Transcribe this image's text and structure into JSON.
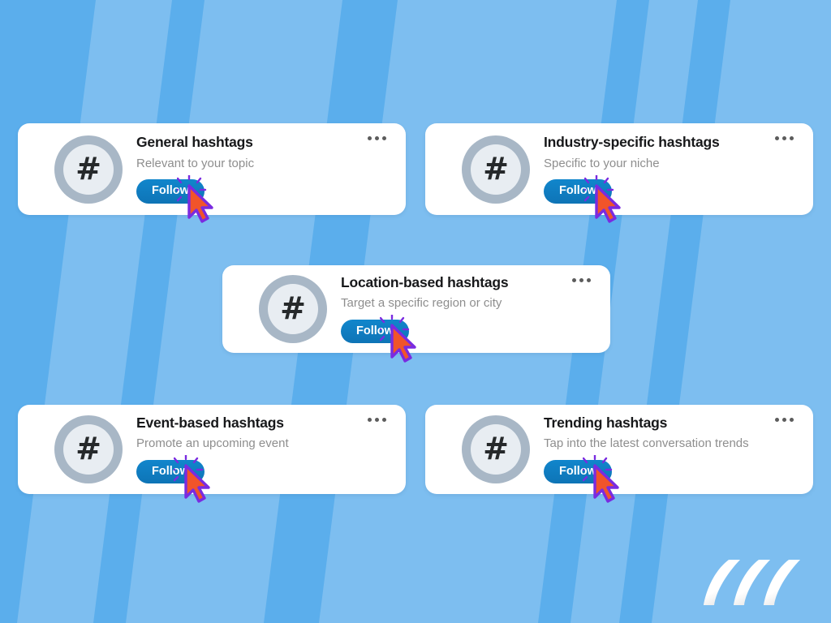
{
  "page": {
    "background_color": "#5BAEEC",
    "stripe_color": "#7DBEF0",
    "card_background": "#FFFFFF",
    "accent_color": "#0F7BBF",
    "title_color": "#17181A",
    "subtitle_color": "#8E8E8E",
    "cursor_fill": "#F15A29",
    "cursor_outline": "#6B2BD9"
  },
  "cards": [
    {
      "title": "General hashtags",
      "subtitle": "Relevant to your topic",
      "button_label": "Follow",
      "avatar_icon": "hashtag-icon",
      "avatar_glyph": "#",
      "menu_icon": "more-options-icon"
    },
    {
      "title": "Industry-specific hashtags",
      "subtitle": "Specific to your niche",
      "button_label": "Follow",
      "avatar_icon": "hashtag-icon",
      "avatar_glyph": "#",
      "menu_icon": "more-options-icon"
    },
    {
      "title": "Location-based hashtags",
      "subtitle": "Target a specific region or city",
      "button_label": "Follow",
      "avatar_icon": "hashtag-icon",
      "avatar_glyph": "#",
      "menu_icon": "more-options-icon"
    },
    {
      "title": "Event-based hashtags",
      "subtitle": "Promote an upcoming event",
      "button_label": "Follow",
      "avatar_icon": "hashtag-icon",
      "avatar_glyph": "#",
      "menu_icon": "more-options-icon"
    },
    {
      "title": "Trending hashtags",
      "subtitle": "Tap into the latest conversation trends",
      "button_label": "Follow",
      "avatar_icon": "hashtag-icon",
      "avatar_glyph": "#",
      "menu_icon": "more-options-icon"
    }
  ],
  "logo": {
    "icon": "brand-logo-icon",
    "color": "#FFFFFF"
  }
}
